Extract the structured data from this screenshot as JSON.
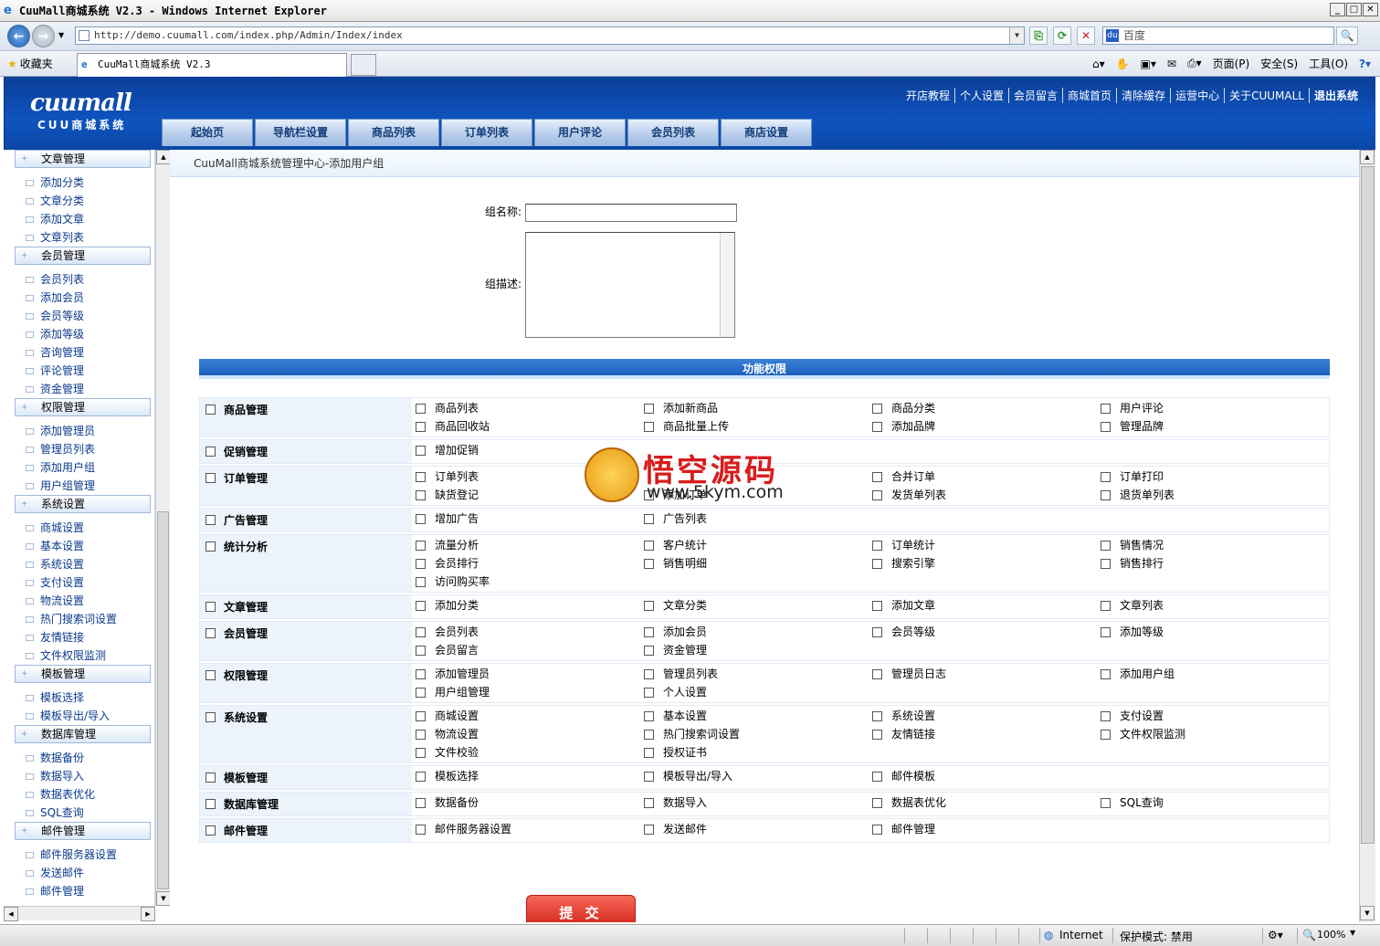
{
  "browser": {
    "title": "CuuMall商城系统 V2.3 - Windows Internet Explorer",
    "url": "http://demo.cuumall.com/index.php/Admin/Index/index",
    "search_placeholder": "百度",
    "favorites": "收藏夹",
    "tab_title": "CuuMall商城系统 V2.3",
    "commands": [
      "页面(P)",
      "安全(S)",
      "工具(O)"
    ],
    "status_zone": "Internet",
    "status_protect": "保护模式: 禁用",
    "zoom": "100%"
  },
  "header": {
    "logo_main": "cuumall",
    "logo_sub": "CUU商城系统",
    "top_links": [
      "开店教程",
      "个人设置",
      "会员留言",
      "商城首页",
      "清除缓存",
      "运营中心",
      "关于CUUMALL",
      "退出系统"
    ],
    "nav": [
      "起始页",
      "导航栏设置",
      "商品列表",
      "订单列表",
      "用户评论",
      "会员列表",
      "商店设置"
    ]
  },
  "sidebar": {
    "groups": [
      {
        "title": "文章管理",
        "items": [
          "添加分类",
          "文章分类",
          "添加文章",
          "文章列表"
        ]
      },
      {
        "title": "会员管理",
        "items": [
          "会员列表",
          "添加会员",
          "会员等级",
          "添加等级",
          "咨询管理",
          "评论管理",
          "资金管理"
        ]
      },
      {
        "title": "权限管理",
        "items": [
          "添加管理员",
          "管理员列表",
          "添加用户组",
          "用户组管理"
        ]
      },
      {
        "title": "系统设置",
        "items": [
          "商城设置",
          "基本设置",
          "系统设置",
          "支付设置",
          "物流设置",
          "热门搜索词设置",
          "友情链接",
          "文件权限监测"
        ]
      },
      {
        "title": "模板管理",
        "items": [
          "模板选择",
          "模板导出/导入"
        ]
      },
      {
        "title": "数据库管理",
        "items": [
          "数据备份",
          "数据导入",
          "数据表优化",
          "SQL查询"
        ]
      },
      {
        "title": "邮件管理",
        "items": [
          "邮件服务器设置",
          "发送邮件",
          "邮件管理"
        ]
      }
    ]
  },
  "main": {
    "breadcrumb": "CuuMall商城系统管理中心-添加用户组",
    "group_name_label": "组名称:",
    "group_name_value": "",
    "group_desc_label": "组描述:",
    "group_desc_value": "",
    "perm_title": "功能权限",
    "submit_label": "提 交",
    "permissions": [
      {
        "category": "商品管理",
        "items": [
          "商品列表",
          "添加新商品",
          "商品分类",
          "用户评论",
          "商品回收站",
          "商品批量上传",
          "添加品牌",
          "管理品牌"
        ]
      },
      {
        "category": "促销管理",
        "items": [
          "增加促销"
        ]
      },
      {
        "category": "订单管理",
        "items": [
          "订单列表",
          "",
          "合并订单",
          "订单打印",
          "缺货登记",
          "添加订单",
          "发货单列表",
          "退货单列表"
        ]
      },
      {
        "category": "广告管理",
        "items": [
          "增加广告",
          "广告列表"
        ]
      },
      {
        "category": "统计分析",
        "items": [
          "流量分析",
          "客户统计",
          "订单统计",
          "销售情况",
          "会员排行",
          "销售明细",
          "搜索引擎",
          "销售排行",
          "访问购买率"
        ]
      },
      {
        "category": "文章管理",
        "items": [
          "添加分类",
          "文章分类",
          "添加文章",
          "文章列表"
        ]
      },
      {
        "category": "会员管理",
        "items": [
          "会员列表",
          "添加会员",
          "会员等级",
          "添加等级",
          "会员留言",
          "资金管理"
        ]
      },
      {
        "category": "权限管理",
        "items": [
          "添加管理员",
          "管理员列表",
          "管理员日志",
          "添加用户组",
          "用户组管理",
          "个人设置"
        ]
      },
      {
        "category": "系统设置",
        "items": [
          "商城设置",
          "基本设置",
          "系统设置",
          "支付设置",
          "物流设置",
          "热门搜索词设置",
          "友情链接",
          "文件权限监测",
          "文件校验",
          "授权证书"
        ]
      },
      {
        "category": "模板管理",
        "items": [
          "模板选择",
          "模板导出/导入",
          "邮件模板"
        ]
      },
      {
        "category": "数据库管理",
        "items": [
          "数据备份",
          "数据导入",
          "数据表优化",
          "SQL查询"
        ]
      },
      {
        "category": "邮件管理",
        "items": [
          "邮件服务器设置",
          "发送邮件",
          "邮件管理"
        ]
      }
    ]
  },
  "watermark": {
    "title": "悟空源码",
    "site": "www.5kym.com"
  }
}
